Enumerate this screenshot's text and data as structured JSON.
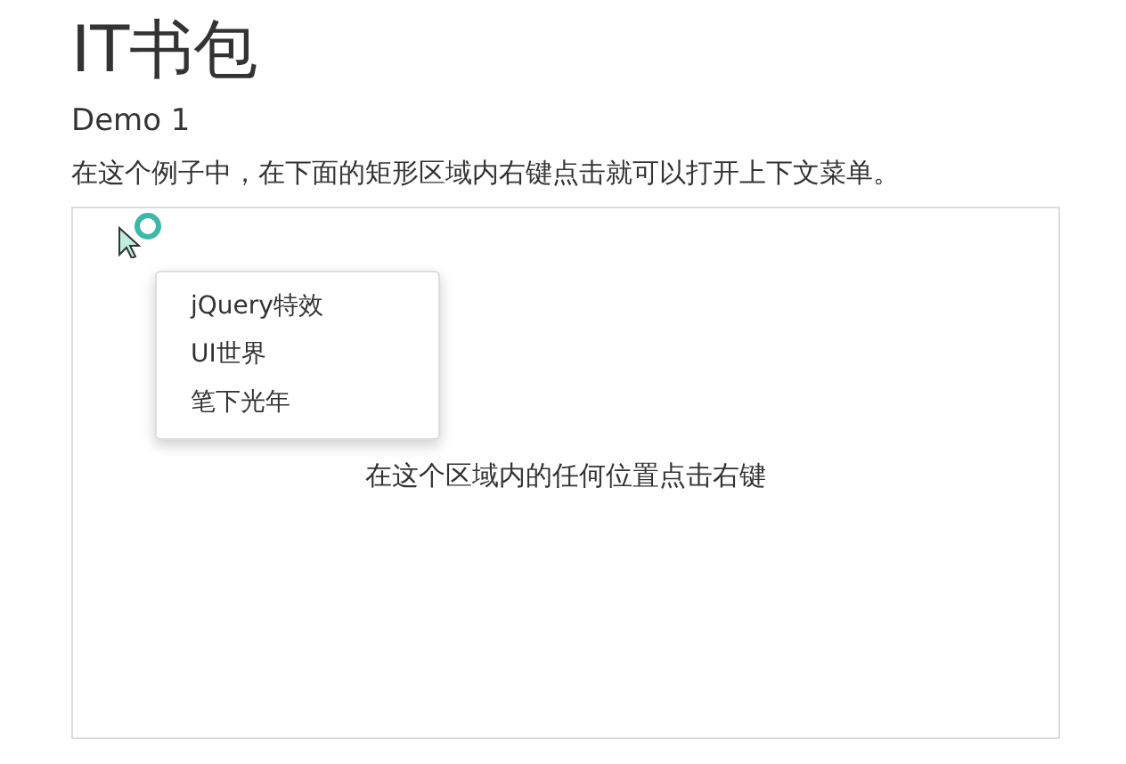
{
  "page": {
    "title": "IT书包",
    "subtitle": "Demo 1",
    "description": "在这个例子中，在下面的矩形区域内右键点击就可以打开上下文菜单。"
  },
  "area": {
    "hint": "在这个区域内的任何位置点击右键"
  },
  "context_menu": {
    "items": [
      {
        "label": "jQuery特效"
      },
      {
        "label": "UI世界"
      },
      {
        "label": "笔下光年"
      }
    ]
  }
}
